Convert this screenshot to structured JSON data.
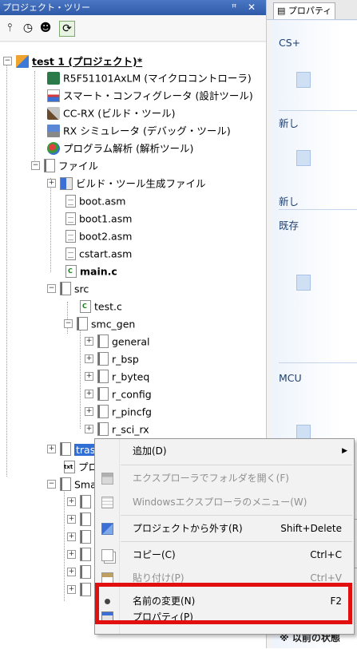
{
  "tree_panel": {
    "title": "プロジェクト・ツリー",
    "pin_glyph": "ꟸ",
    "close_glyph": "✕"
  },
  "tree": {
    "project": "test 1  (プロジェクト)*",
    "device": "R5F51101AxLM (マイクロコントローラ)",
    "smart_config": "スマート・コンフィグレータ (設計ツール)",
    "ccrx": "CC-RX (ビルド・ツール)",
    "rx_sim": "RX シミュレータ (デバッグ・ツール)",
    "program_analysis": "プログラム解析 (解析ツール)",
    "files": "ファイル",
    "build_generated": "ビルド・ツール生成ファイル",
    "boot": "boot.asm",
    "boot1": "boot1.asm",
    "boot2": "boot2.asm",
    "cstart": "cstart.asm",
    "mainc": "main.c",
    "src": "src",
    "testc": "test.c",
    "smc_gen": "smc_gen",
    "general": "general",
    "r_bsp": "r_bsp",
    "r_byteq": "r_byteq",
    "r_config": "r_config",
    "r_pincfg": "r_pincfg",
    "r_sci_rx": "r_sci_rx",
    "trash": "tras",
    "txt_item": "プロ",
    "sm_item": "Sma"
  },
  "properties_panel": {
    "tab_label": "プロパティ",
    "group1": "CS+",
    "group2": "新し",
    "group3": "新し",
    "group4": "既存",
    "group5": "MCU",
    "bottom_text": "※ 以前の状態"
  },
  "context_menu": {
    "add": "追加(D)",
    "open_explorer": "エクスプローラでフォルダを開く(F)",
    "windows_menu": "Windowsエクスプローラのメニュー(W)",
    "remove_from_project": "プロジェクトから外す(R)",
    "remove_shortcut": "Shift+Delete",
    "copy": "コピー(C)",
    "copy_shortcut": "Ctrl+C",
    "paste": "貼り付け(P)",
    "paste_shortcut": "Ctrl+V",
    "rename": "名前の変更(N)",
    "rename_shortcut": "F2",
    "properties": "プロパティ(P)"
  },
  "colors": {
    "titlebar": "#2f5aa8",
    "selection": "#2f6fd6",
    "highlight_box": "#e20f0f"
  }
}
